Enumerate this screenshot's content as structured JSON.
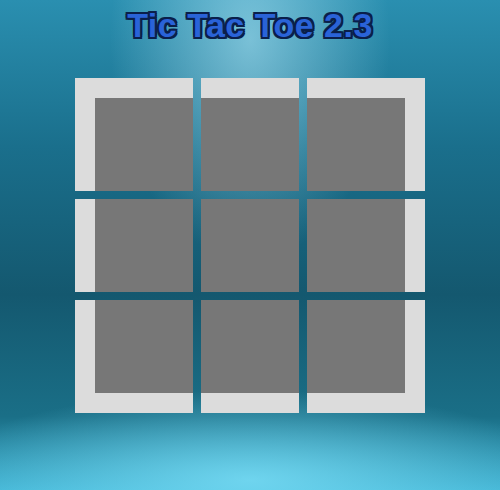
{
  "window": {
    "title": "Tic Tac Toe 2.3"
  },
  "board": {
    "cells": [
      {
        "mark": ""
      },
      {
        "mark": ""
      },
      {
        "mark": ""
      },
      {
        "mark": ""
      },
      {
        "mark": ""
      },
      {
        "mark": ""
      },
      {
        "mark": ""
      },
      {
        "mark": ""
      },
      {
        "mark": ""
      }
    ]
  }
}
